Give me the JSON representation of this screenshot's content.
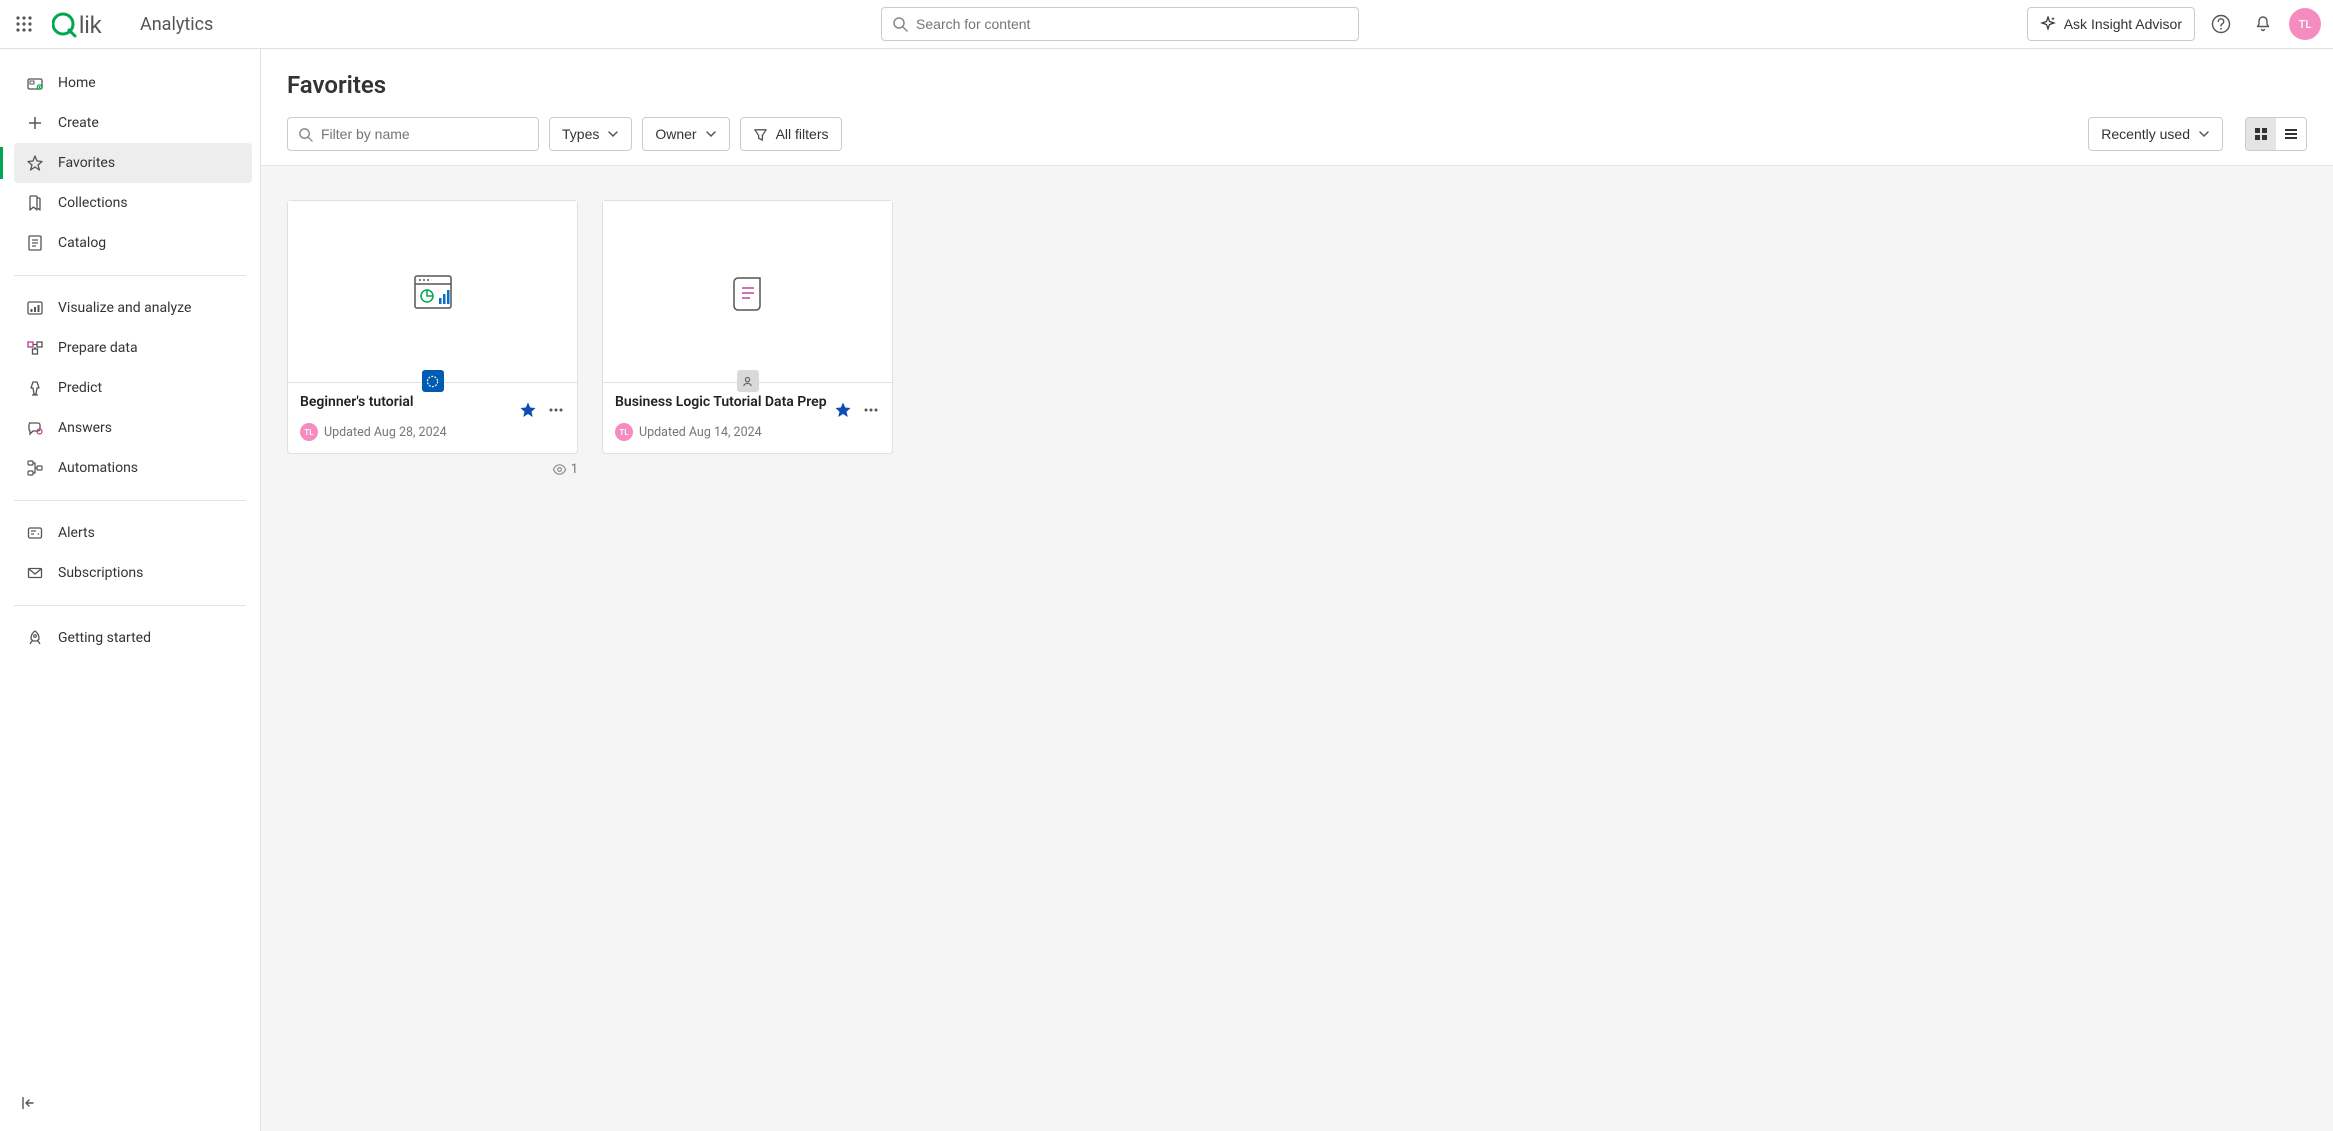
{
  "header": {
    "logo_text": "Qlik",
    "logo_section": "Analytics",
    "search_placeholder": "Search for content",
    "insight_label": "Ask Insight Advisor",
    "avatar_initials": "TL"
  },
  "sidebar": {
    "group1": [
      {
        "icon": "home-icon",
        "label": "Home"
      },
      {
        "icon": "plus-icon",
        "label": "Create"
      },
      {
        "icon": "star-icon",
        "label": "Favorites",
        "active": true
      },
      {
        "icon": "bookmark-icon",
        "label": "Collections"
      },
      {
        "icon": "catalog-icon",
        "label": "Catalog"
      }
    ],
    "group2": [
      {
        "icon": "chart-icon",
        "label": "Visualize and analyze"
      },
      {
        "icon": "prepare-icon",
        "label": "Prepare data"
      },
      {
        "icon": "predict-icon",
        "label": "Predict"
      },
      {
        "icon": "answers-icon",
        "label": "Answers"
      },
      {
        "icon": "automations-icon",
        "label": "Automations"
      }
    ],
    "group3": [
      {
        "icon": "alerts-icon",
        "label": "Alerts"
      },
      {
        "icon": "subscriptions-icon",
        "label": "Subscriptions"
      }
    ],
    "group4": [
      {
        "icon": "rocket-icon",
        "label": "Getting started"
      }
    ]
  },
  "page": {
    "title": "Favorites",
    "filter_placeholder": "Filter by name",
    "types_label": "Types",
    "owner_label": "Owner",
    "allfilters_label": "All filters",
    "sort_label": "Recently used"
  },
  "cards": [
    {
      "title": "Beginner's tutorial",
      "updated": "Updated Aug 28, 2024",
      "avatar": "TL",
      "badge": "blue",
      "views": "1",
      "thumb_type": "app"
    },
    {
      "title": "Business Logic Tutorial Data Prep",
      "updated": "Updated Aug 14, 2024",
      "avatar": "TL",
      "badge": "gray",
      "thumb_type": "script"
    }
  ]
}
